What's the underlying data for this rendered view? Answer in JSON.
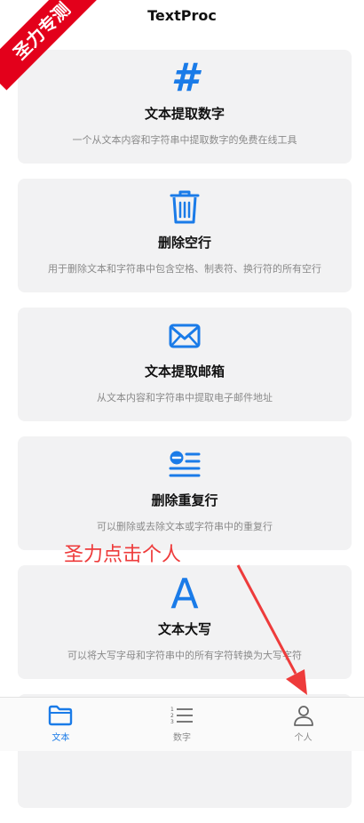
{
  "app": {
    "title": "TextProc"
  },
  "ribbon": {
    "text": "圣力专测"
  },
  "cards": [
    {
      "title": "文本提取数字",
      "desc": "一个从文本内容和字符串中提取数字的免费在线工具",
      "icon": "hash-icon",
      "glyph": "#"
    },
    {
      "title": "删除空行",
      "desc": "用于删除文本和字符串中包含空格、制表符、换行符的所有空行",
      "icon": "trash-icon"
    },
    {
      "title": "文本提取邮箱",
      "desc": "从文本内容和字符串中提取电子邮件地址",
      "icon": "envelope-icon"
    },
    {
      "title": "删除重复行",
      "desc": "可以删除或去除文本或字符串中的重复行",
      "icon": "remove-lines-icon"
    },
    {
      "title": "文本大写",
      "desc": "可以将大写字母和字符串中的所有字符转换为大写字符",
      "icon": "letter-a-icon",
      "glyph": "A"
    }
  ],
  "annotation": {
    "text": "圣力点击个人"
  },
  "tabbar": {
    "items": [
      {
        "label": "文本",
        "icon": "folder-icon",
        "active": true
      },
      {
        "label": "数字",
        "icon": "numbered-list-icon",
        "active": false
      },
      {
        "label": "个人",
        "icon": "person-icon",
        "active": false
      }
    ]
  },
  "colors": {
    "accent": "#1a7be8",
    "card_bg": "#f2f2f3",
    "ribbon": "#e3001b",
    "annotation": "#ee3b3b"
  }
}
